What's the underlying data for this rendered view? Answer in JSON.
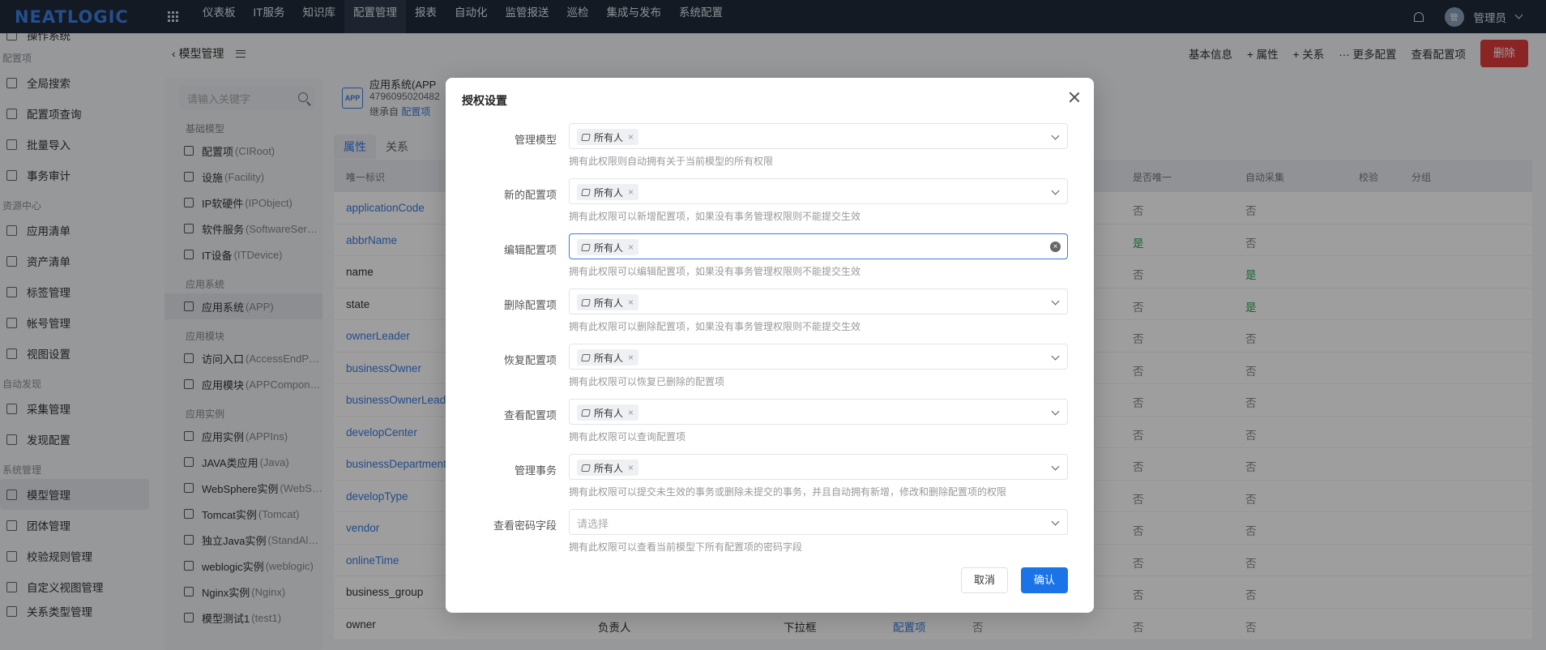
{
  "topbar": {
    "logo": "NEATLOGIC",
    "nav": [
      "仪表板",
      "IT服务",
      "知识库",
      "配置管理",
      "报表",
      "自动化",
      "监管报送",
      "巡检",
      "集成与发布",
      "系统配置"
    ],
    "active_nav": "配置管理",
    "avatar_text": "管",
    "user": "管理员"
  },
  "sidebar": {
    "cut_top": "操作系统",
    "groups": [
      {
        "label": "配置项",
        "items": [
          "全局搜索",
          "配置项查询",
          "批量导入",
          "事务审计"
        ]
      },
      {
        "label": "资源中心",
        "items": [
          "应用清单",
          "资产清单",
          "标签管理",
          "帐号管理",
          "视图设置"
        ]
      },
      {
        "label": "自动发现",
        "items": [
          "采集管理",
          "发现配置"
        ]
      },
      {
        "label": "系统管理",
        "items": [
          "模型管理",
          "团体管理",
          "校验规则管理",
          "自定义视图管理"
        ]
      }
    ],
    "active_item": "模型管理",
    "cut_bottom": "关系类型管理"
  },
  "header": {
    "back_label": "模型管理",
    "actions": [
      "基本信息",
      "+ 属性",
      "+ 关系",
      "··· 更多配置",
      "查看配置项"
    ],
    "delete_label": "删除"
  },
  "tree": {
    "search_placeholder": "请输入关键字",
    "groups": [
      {
        "label": "基础模型",
        "items": [
          [
            "配置项",
            "(CIRoot)"
          ],
          [
            "设施",
            "(Facility)"
          ],
          [
            "IP软硬件",
            "(IPObject)"
          ],
          [
            "软件服务",
            "(SoftwareSer…"
          ],
          [
            "IT设备",
            "(ITDevice)"
          ]
        ]
      },
      {
        "label": "应用系统",
        "items": [
          [
            "应用系统",
            "(APP)"
          ]
        ]
      },
      {
        "label": "应用模块",
        "items": [
          [
            "访问入口",
            "(AccessEndP…"
          ],
          [
            "应用模块",
            "(APPCompon…"
          ]
        ]
      },
      {
        "label": "应用实例",
        "items": [
          [
            "应用实例",
            "(APPIns)"
          ],
          [
            "JAVA类应用",
            "(Java)"
          ],
          [
            "WebSphere实例",
            "(WebS…"
          ],
          [
            "Tomcat实例",
            "(Tomcat)"
          ],
          [
            "独立Java实例",
            "(StandAl…"
          ],
          [
            "weblogic实例",
            "(weblogic)"
          ],
          [
            "Nginx实例",
            "(Nginx)"
          ],
          [
            "模型测试1",
            "(test1)"
          ]
        ]
      }
    ],
    "active_item": "应用系统"
  },
  "model": {
    "badge": "APP",
    "name": "应用系统(APP",
    "id": "4796095020482",
    "inherit_prefix": "继承自",
    "inherit_link": "配置项",
    "tabs": [
      "属性",
      "关系"
    ],
    "active_tab": "属性"
  },
  "table": {
    "headers": [
      "唯一标识",
      "是否唯一",
      "自动采集",
      "校验",
      "分组"
    ],
    "rows": [
      {
        "key": "applicationCode",
        "link": true,
        "uniq": "否",
        "auto": "否"
      },
      {
        "key": "abbrName",
        "link": true,
        "uniq": "是",
        "auto": "否"
      },
      {
        "key": "name",
        "link": false,
        "uniq": "否",
        "auto": "是"
      },
      {
        "key": "state",
        "link": false,
        "uniq": "否",
        "auto": "是"
      },
      {
        "key": "ownerLeader",
        "link": true,
        "uniq": "否",
        "auto": "否"
      },
      {
        "key": "businessOwner",
        "link": true,
        "uniq": "否",
        "auto": "否"
      },
      {
        "key": "businessOwnerLead",
        "link": true,
        "uniq": "否",
        "auto": "否"
      },
      {
        "key": "developCenter",
        "link": true,
        "uniq": "否",
        "auto": "否"
      },
      {
        "key": "businessDepartment",
        "link": true,
        "uniq": "否",
        "auto": "否"
      },
      {
        "key": "developType",
        "link": true,
        "uniq": "否",
        "auto": "否"
      },
      {
        "key": "vendor",
        "link": true,
        "uniq": "否",
        "auto": "否"
      },
      {
        "key": "onlineTime",
        "link": true,
        "uniq": "否",
        "auto": "否"
      },
      {
        "key": "business_group",
        "link": false,
        "uniq": "否",
        "auto": "否"
      },
      {
        "key": "owner",
        "link": false,
        "name": "负责人",
        "type": "下拉框",
        "target": "配置项",
        "fy": "否",
        "uniq": "否",
        "auto": "否"
      }
    ]
  },
  "modal": {
    "title": "授权设置",
    "tag_label": "所有人",
    "fields": [
      {
        "label": "管理模型",
        "tag": true,
        "help": "拥有此权限则自动拥有关于当前模型的所有权限"
      },
      {
        "label": "新的配置项",
        "tag": true,
        "help": "拥有此权限可以新增配置项，如果没有事务管理权限则不能提交生效"
      },
      {
        "label": "编辑配置项",
        "tag": true,
        "focus": true,
        "help": "拥有此权限可以编辑配置项，如果没有事务管理权限则不能提交生效"
      },
      {
        "label": "删除配置项",
        "tag": true,
        "help": "拥有此权限可以删除配置项，如果没有事务管理权限则不能提交生效"
      },
      {
        "label": "恢复配置项",
        "tag": true,
        "help": "拥有此权限可以恢复已删除的配置项"
      },
      {
        "label": "查看配置项",
        "tag": true,
        "help": "拥有此权限可以查询配置项"
      },
      {
        "label": "管理事务",
        "tag": true,
        "help": "拥有此权限可以提交未生效的事务或删除未提交的事务，并且自动拥有新增，修改和删除配置项的权限"
      },
      {
        "label": "查看密码字段",
        "tag": false,
        "placeholder": "请选择",
        "help": "拥有此权限可以查看当前模型下所有配置项的密码字段"
      }
    ],
    "cancel_label": "取消",
    "ok_label": "确认"
  }
}
